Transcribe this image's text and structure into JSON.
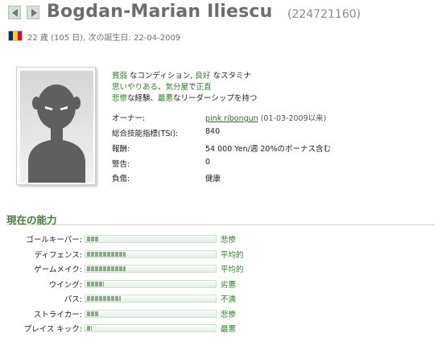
{
  "header": {
    "player_name": "Bogdan-Marian Iliescu",
    "player_id": "(224721160)",
    "age_line": "22 歳 (105 日), 次の誕生日: 22-04-2009"
  },
  "flag": {
    "colors": [
      "#002b7f",
      "#fcd116",
      "#ce1126"
    ]
  },
  "avatar": {
    "icon": "silhouette-avatar-icon"
  },
  "traits": [
    [
      {
        "text": "貧弱",
        "lvl": true
      },
      {
        "text": " なコンディション, "
      },
      {
        "text": "良好",
        "lvl": true
      },
      {
        "text": " なスタミナ"
      }
    ],
    [
      {
        "text": "思いやりある",
        "lvl": true
      },
      {
        "text": "、"
      },
      {
        "text": "気分屋",
        "lvl": true
      },
      {
        "text": "で"
      },
      {
        "text": "正直",
        "lvl": true
      }
    ],
    [
      {
        "text": "悲惨",
        "lvl": true
      },
      {
        "text": "な経験、"
      },
      {
        "text": "最悪",
        "lvl": true
      },
      {
        "text": "なリーダーシップを持つ"
      }
    ]
  ],
  "info": {
    "owner_label": "オーナー:",
    "owner_link": "pink ribongun",
    "owner_since": " (01-03-2009以来)",
    "tsi_label": "総合技能指標(TSI):",
    "tsi_value": "840",
    "wage_label": "報酬:",
    "wage_value": "54 000 Yen/週 20%のボーナス含む",
    "warnings_label": "警告:",
    "warnings_value": "0",
    "injury_label": "負傷:",
    "injury_value": "健康"
  },
  "skills_section": {
    "title": "現在の能力"
  },
  "skills": [
    {
      "label": "ゴールキーパー:",
      "level": "悲惨",
      "fill": 0.09
    },
    {
      "label": "ディフェンス:",
      "level": "平均的",
      "fill": 0.3
    },
    {
      "label": "ゲームメイク:",
      "level": "平均的",
      "fill": 0.3
    },
    {
      "label": "ウイング:",
      "level": "劣悪",
      "fill": 0.13
    },
    {
      "label": "パス:",
      "level": "不満",
      "fill": 0.26
    },
    {
      "label": "ストライカー:",
      "level": "悲惨",
      "fill": 0.09
    },
    {
      "label": "プレイス キック:",
      "level": "最悪",
      "fill": 0.04
    }
  ]
}
